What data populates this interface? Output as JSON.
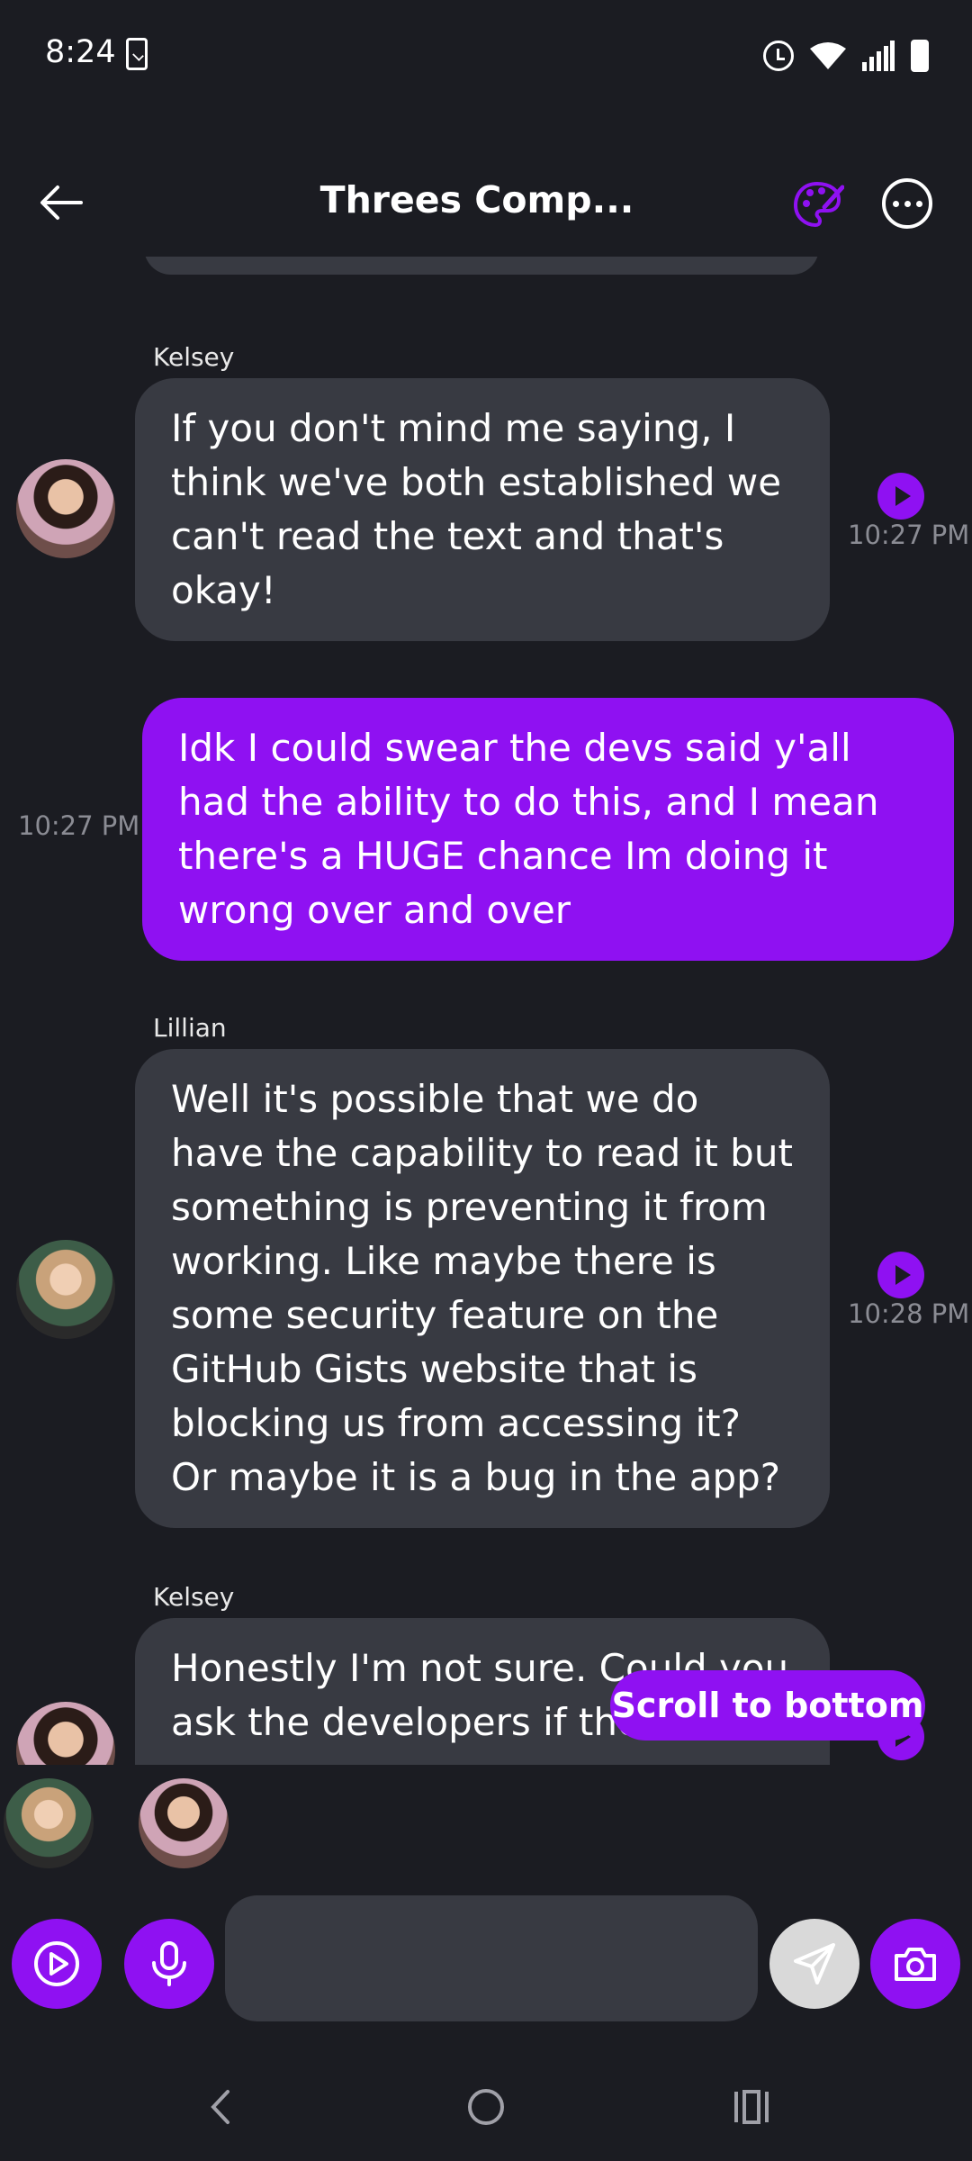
{
  "status_bar": {
    "time": "8:24",
    "icons": [
      "task-check-icon",
      "alarm-icon",
      "wifi-icon",
      "signal-icon",
      "battery-icon"
    ]
  },
  "header": {
    "title": "Threes Comp...",
    "back_icon": "arrow-left-icon",
    "palette_icon": "palette-icon",
    "more_icon": "more-horizontal-icon",
    "accent_color": "#8f11f2"
  },
  "messages": [
    {
      "sender": "Kelsey",
      "text": "If you don't mind me saying, I think we've both established we can't read the text and that's okay!",
      "time": "10:27 PM",
      "from_me": false
    },
    {
      "sender": "",
      "text": "Idk I could swear the devs said y'all had the ability to do this, and I mean there's a HUGE chance Im doing it wrong over and over",
      "time": "10:27 PM",
      "from_me": true
    },
    {
      "sender": "Lillian",
      "text": "Well it's possible that we do have the capability to read it but something is preventing it from working. Like maybe there is some security feature on the GitHub Gists website that is blocking us from accessing it? Or maybe it is a bug in the app?",
      "time": "10:28 PM",
      "from_me": false
    },
    {
      "sender": "Kelsey",
      "text": "Honestly I'm not sure. Could you ask the developers if there",
      "time": "",
      "from_me": false
    }
  ],
  "scroll_to_bottom_label": "Scroll to bottom",
  "participants": [
    "Lillian",
    "Kelsey"
  ],
  "input": {
    "placeholder": "",
    "value": ""
  },
  "colors": {
    "background": "#1b1c22",
    "bubble_them": "#383a42",
    "bubble_me": "#8f11f2",
    "time_text": "#8b8c94"
  }
}
